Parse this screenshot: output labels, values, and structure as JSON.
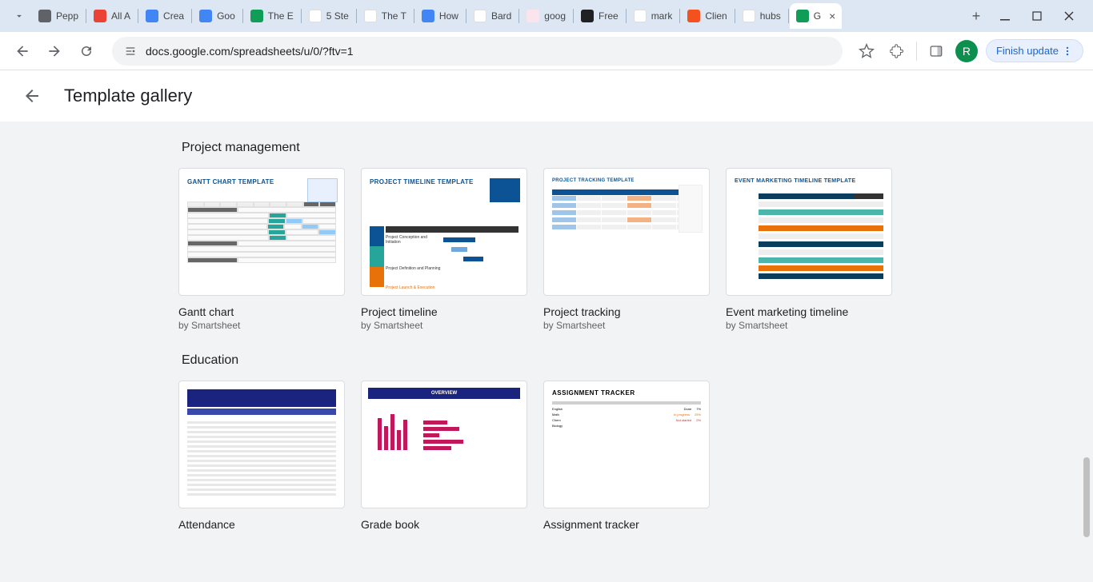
{
  "browser": {
    "tabs": [
      {
        "title": "Pepp",
        "favicon": "pepper-icon",
        "fclass": "fi-gray"
      },
      {
        "title": "All A",
        "favicon": "calendar-icon",
        "fclass": "fi-red"
      },
      {
        "title": "Crea",
        "favicon": "docs-icon",
        "fclass": "fi-docs"
      },
      {
        "title": "Goo",
        "favicon": "docs-icon",
        "fclass": "fi-docs"
      },
      {
        "title": "The E",
        "favicon": "sheets-icon",
        "fclass": "fi-sheets"
      },
      {
        "title": "5 Ste",
        "favicon": "frog-icon",
        "fclass": "fi-white"
      },
      {
        "title": "The T",
        "favicon": "clickup-icon",
        "fclass": "fi-white"
      },
      {
        "title": "How",
        "favicon": "docs-icon",
        "fclass": "fi-docs"
      },
      {
        "title": "Bard",
        "favicon": "bard-icon",
        "fclass": "fi-white"
      },
      {
        "title": "goog",
        "favicon": "craft-icon",
        "fclass": "fi-pink"
      },
      {
        "title": "Free",
        "favicon": "vercel-icon",
        "fclass": "fi-dark"
      },
      {
        "title": "mark",
        "favicon": "google-icon",
        "fclass": "fi-white"
      },
      {
        "title": "Clien",
        "favicon": "etsy-icon",
        "fclass": "fi-orange"
      },
      {
        "title": "hubs",
        "favicon": "google-icon",
        "fclass": "fi-white"
      },
      {
        "title": "G",
        "favicon": "sheets-icon",
        "fclass": "fi-sheets",
        "active": true
      }
    ],
    "url": "docs.google.com/spreadsheets/u/0/?ftv=1",
    "update_label": "Finish update",
    "avatar_letter": "R"
  },
  "page": {
    "title": "Template gallery"
  },
  "sections": [
    {
      "title": "Project management",
      "cards": [
        {
          "name": "Gantt chart",
          "by": "by Smartsheet",
          "thumb_title": "GANTT CHART TEMPLATE"
        },
        {
          "name": "Project timeline",
          "by": "by Smartsheet",
          "thumb_title": "PROJECT TIMELINE TEMPLATE"
        },
        {
          "name": "Project tracking",
          "by": "by Smartsheet",
          "thumb_title": "PROJECT TRACKING TEMPLATE"
        },
        {
          "name": "Event marketing timeline",
          "by": "by Smartsheet",
          "thumb_title": "EVENT MARKETING TIMELINE TEMPLATE"
        }
      ]
    },
    {
      "title": "Education",
      "cards": [
        {
          "name": "Attendance",
          "by": "",
          "thumb_title": ""
        },
        {
          "name": "Grade book",
          "by": "",
          "thumb_title": "OVERVIEW"
        },
        {
          "name": "Assignment tracker",
          "by": "",
          "thumb_title": "ASSIGNMENT TRACKER"
        }
      ]
    }
  ],
  "thumb_labels": {
    "project_conception": "Project Conception and Initiation",
    "project_planning": "Project Definition and Planning",
    "project_execution": "Project Launch & Execution"
  }
}
